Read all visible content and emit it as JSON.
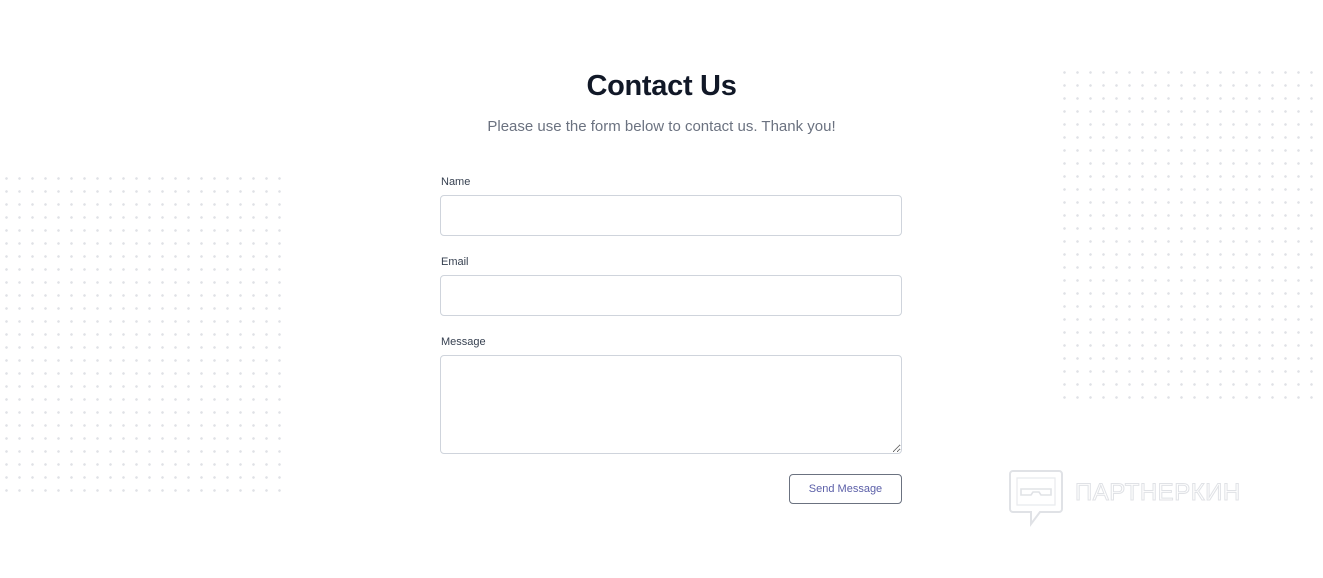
{
  "page": {
    "title": "Contact Us",
    "subtitle": "Please use the form below to contact us. Thank you!"
  },
  "form": {
    "name_label": "Name",
    "name_value": "",
    "email_label": "Email",
    "email_value": "",
    "message_label": "Message",
    "message_value": "",
    "submit_label": "Send Message"
  },
  "watermark": {
    "text": "ПАРТНЕРКИН",
    "icon": "speech-bubble-mask-icon"
  },
  "colors": {
    "title": "#111827",
    "subtitle": "#6b7280",
    "input_border": "#cfd4dc",
    "button_text": "#5b5fa8",
    "dots": "#dfe1e6"
  }
}
